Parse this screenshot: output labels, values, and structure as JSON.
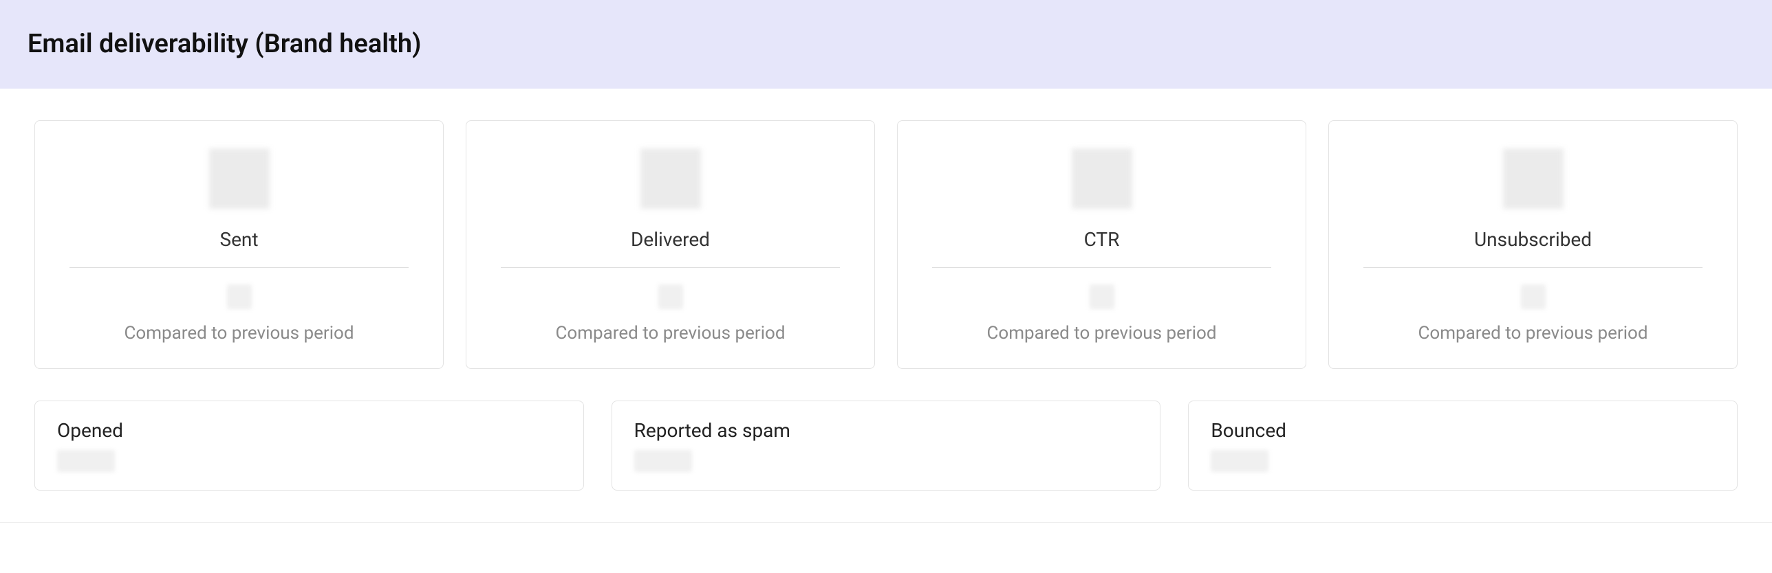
{
  "header": {
    "title": "Email deliverability (Brand health)"
  },
  "compare_text": "Compared to previous period",
  "stats": [
    {
      "label": "Sent"
    },
    {
      "label": "Delivered"
    },
    {
      "label": "CTR"
    },
    {
      "label": "Unsubscribed"
    }
  ],
  "status": [
    {
      "label": "Opened"
    },
    {
      "label": "Reported as spam"
    },
    {
      "label": "Bounced"
    }
  ]
}
